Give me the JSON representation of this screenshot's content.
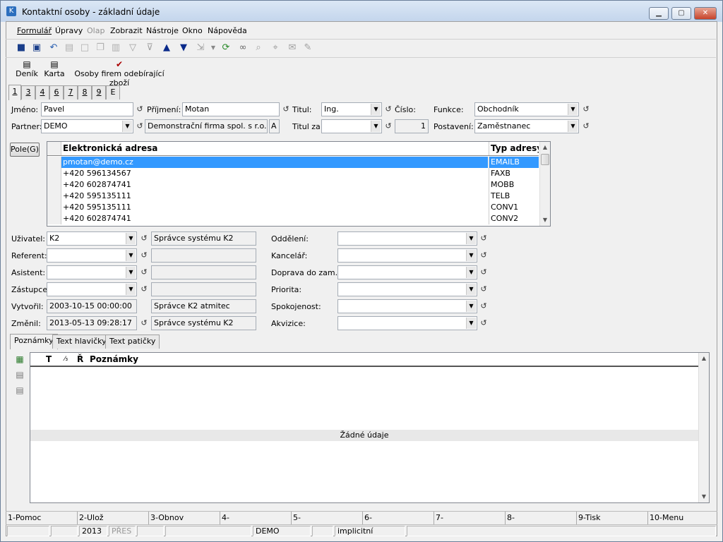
{
  "window": {
    "title": "Kontaktní osoby - základní údaje",
    "min": "▁",
    "max": "▢",
    "close": "✕"
  },
  "menu": [
    {
      "label": "Formulář",
      "disabled": false
    },
    {
      "label": "Úpravy",
      "disabled": false
    },
    {
      "label": "Olap",
      "disabled": true
    },
    {
      "label": "Zobrazit",
      "disabled": false
    },
    {
      "label": "Nástroje",
      "disabled": false
    },
    {
      "label": "Okno",
      "disabled": false
    },
    {
      "label": "Nápověda",
      "disabled": false
    }
  ],
  "toolbar2": {
    "denik": "Deník",
    "karta": "Karta",
    "osoby": "Osoby firem odebírající zboží"
  },
  "tabs": [
    "1",
    "3",
    "4",
    "6",
    "7",
    "8",
    "9",
    "E"
  ],
  "header": {
    "jmeno_label": "Jméno:",
    "jmeno": "Pavel",
    "prijmeni_label": "Příjmení:",
    "prijmeni": "Motan",
    "titul_label": "Titul:",
    "titul": "Ing.",
    "cislo_label": "Číslo:",
    "funkce_label": "Funkce:",
    "funkce": "Obchodník",
    "partner_label": "Partner:",
    "partner": "DEMO",
    "partner_name": "Demonstrační firma spol. s r.o.",
    "partner_flag": "A",
    "titul_za_label": "Titul za:",
    "titul_za": "",
    "cislo_value": "1",
    "postaveni_label": "Postavení:",
    "postaveni": "Zaměstnanec"
  },
  "pole_button": "Pole(G)",
  "addresses": {
    "col_address": "Elektronická adresa",
    "col_type": "Typ adresy",
    "rows": [
      {
        "address": "pmotan@demo.cz",
        "type": "EMAILB"
      },
      {
        "address": "+420 596134567",
        "type": "FAXB"
      },
      {
        "address": "+420 602874741",
        "type": "MOBB"
      },
      {
        "address": "+420 595135111",
        "type": "TELB"
      },
      {
        "address": "+420 595135111",
        "type": "CONV1"
      },
      {
        "address": "+420 602874741",
        "type": "CONV2"
      }
    ]
  },
  "users": {
    "uzivatel_label": "Uživatel:",
    "uzivatel": "K2",
    "uzivatel_name": "Správce systému K2",
    "referent_label": "Referent:",
    "referent": "",
    "referent_name": "",
    "asistent_label": "Asistent:",
    "asistent": "",
    "asistent_name": "",
    "zastupce_label": "Zástupce:",
    "zastupce": "",
    "zastupce_name": "",
    "vytvoril_label": "Vytvořil:",
    "vytvoril": "2003-10-15 00:00:00",
    "vytvoril_name": "Správce K2 atmitec",
    "zmenil_label": "Změnil:",
    "zmenil": "2013-05-13 09:28:17",
    "zmenil_name": "Správce systému K2"
  },
  "dept": {
    "oddeleni": "Oddělení:",
    "kancelar": "Kancelář:",
    "doprava": "Doprava do zam.:",
    "priorita": "Priorita:",
    "spokojenost": "Spokojenost:",
    "akvizice": "Akvizice:"
  },
  "bottom_tabs": [
    "Poznámky",
    "Text hlavičky",
    "Text patičky"
  ],
  "notes": {
    "col_t": "T",
    "col_sort": "⁄₃",
    "col_r": "Ř",
    "col_notes": "Poznámky",
    "empty": "Žádné údaje"
  },
  "fkeys": [
    "1-Pomoc",
    "2-Ulož",
    "3-Obnov",
    "4-",
    "5-",
    "6-",
    "7-",
    "8-",
    "9-Tisk",
    "10-Menu"
  ],
  "status": {
    "year": "2013",
    "mode": "PŘES",
    "company": "DEMO",
    "setting": "implicitní"
  }
}
